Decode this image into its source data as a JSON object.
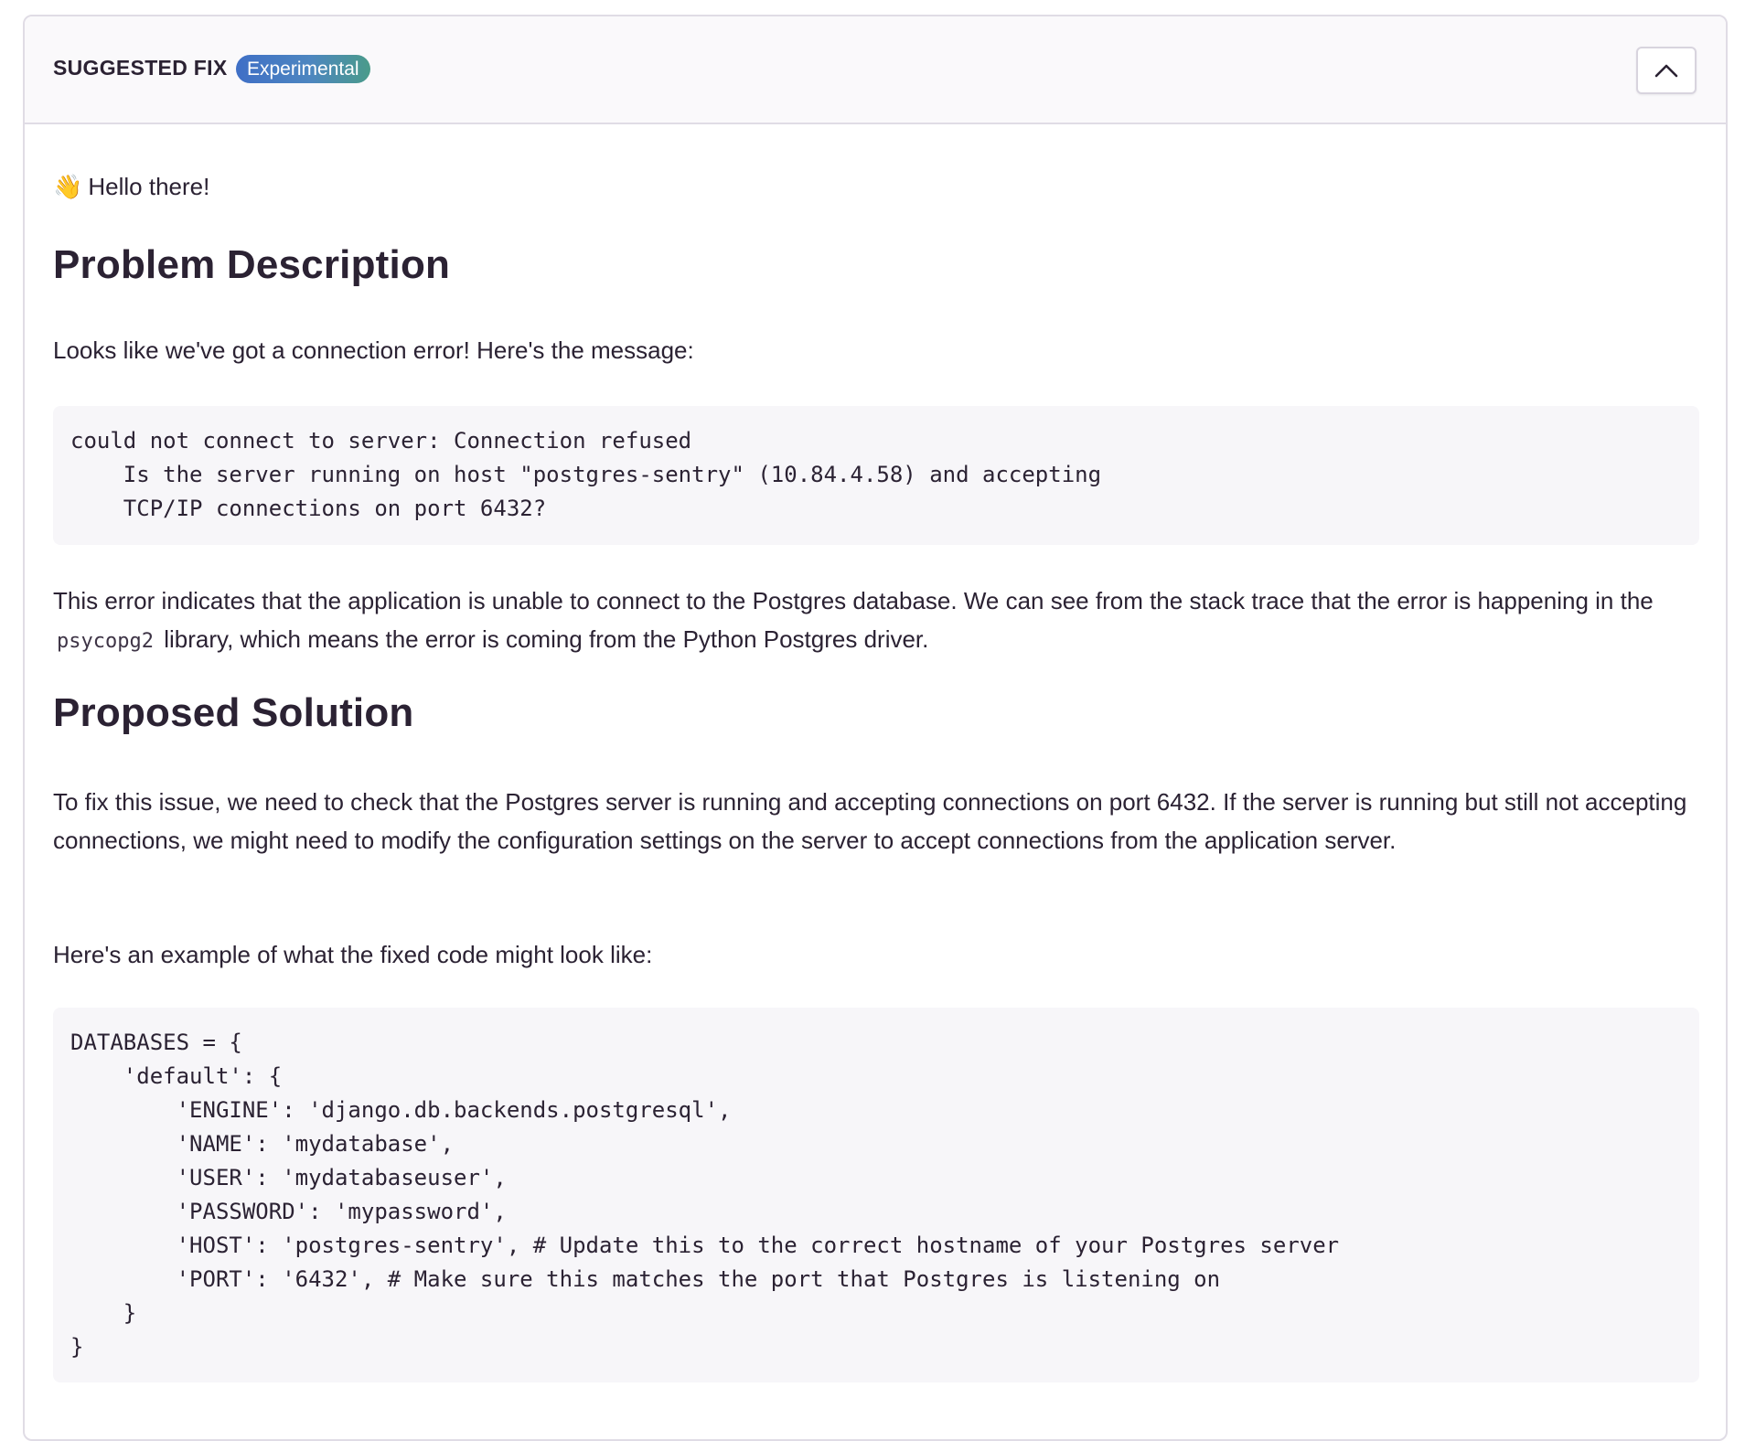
{
  "header": {
    "title": "SUGGESTED FIX",
    "badge": "Experimental",
    "collapse_icon": "chevron-up-icon"
  },
  "content": {
    "greeting_emoji": "👋",
    "greeting_text": "Hello there!",
    "problem_heading": "Problem Description",
    "problem_intro": "Looks like we've got a connection error! Here's the message:",
    "error_message": "could not connect to server: Connection refused\n    Is the server running on host \"postgres-sentry\" (10.84.4.58) and accepting\n    TCP/IP connections on port 6432?",
    "explanation_before": "This error indicates that the application is unable to connect to the Postgres database. We can see from the stack trace that the error is happening in the",
    "explanation_code": "psycopg2",
    "explanation_after": "library, which means the error is coming from the Python Postgres driver.",
    "solution_heading": "Proposed Solution",
    "solution_text": "To fix this issue, we need to check that the Postgres server is running and accepting connections on port 6432. If the server is running but still not accepting connections, we might need to modify the configuration settings on the server to accept connections from the application server.",
    "example_intro": "Here's an example of what the fixed code might look like:",
    "example_code": "DATABASES = {\n    'default': {\n        'ENGINE': 'django.db.backends.postgresql',\n        'NAME': 'mydatabase',\n        'USER': 'mydatabaseuser',\n        'PASSWORD': 'mypassword',\n        'HOST': 'postgres-sentry', # Update this to the correct hostname of your Postgres server\n        'PORT': '6432', # Make sure this matches the port that Postgres is listening on\n    }\n}"
  }
}
